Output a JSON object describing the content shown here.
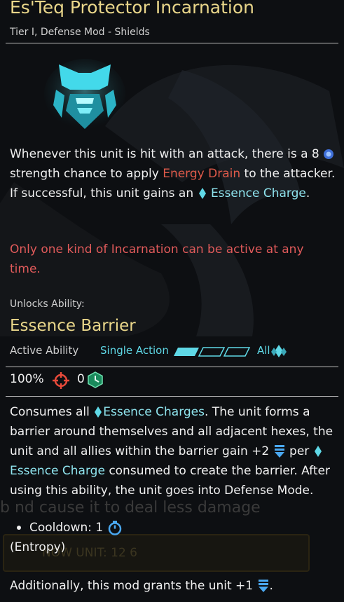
{
  "header": {
    "title": "Es'Teq Protector Incarnation",
    "subtitle": "Tier I, Defense Mod - Shields"
  },
  "description": {
    "part1": "Whenever this unit is hit with an attack, there is a 8",
    "part2": "strength chance to apply",
    "energy_drain": "Energy Drain",
    "part3": "to the attacker. If successful, this unit gains an",
    "essence_charge": "Essence Charge",
    "part4": "."
  },
  "warning": "Only one kind of Incarnation can be active at any time.",
  "unlock_label": "Unlocks Ability:",
  "ability": {
    "name": "Essence Barrier",
    "type": "Active Ability",
    "action": "Single Action",
    "action_pips_filled": 1,
    "action_pips_total": 3,
    "target": "All",
    "accuracy": "100%",
    "cost": "0",
    "desc_1": "Consumes all",
    "essence_charges": "Essence Charges",
    "desc_2": ". The unit forms a barrier around themselves and all adjacent hexes, the unit and all allies within the barrier gain +2",
    "desc_3": "per",
    "essence_charge": "Essence Charge",
    "desc_4": "consumed to create the barrier. After using this ability, the unit goes into Defense Mode.",
    "cooldown": "Cooldown: 1",
    "entropy": "(Entropy)"
  },
  "additional": "Additionally, this mod grants the unit +1",
  "additional_end": ".",
  "background_text": {
    "ghost_line": "b                    nd cause it to deal less damage",
    "ghost_box": "NOW UNIT: 12   6"
  },
  "icons": {
    "strength": "gear-icon",
    "essence": "essence-drop-icon",
    "crosshair": "crosshair-icon",
    "cost": "hex-cost-icon",
    "shield": "shield-stack-icon",
    "timer": "stopwatch-icon"
  },
  "colors": {
    "title": "#e9d68a",
    "cyan": "#5fd8e6",
    "red": "#e05a4a",
    "text": "#f0f0f0"
  }
}
